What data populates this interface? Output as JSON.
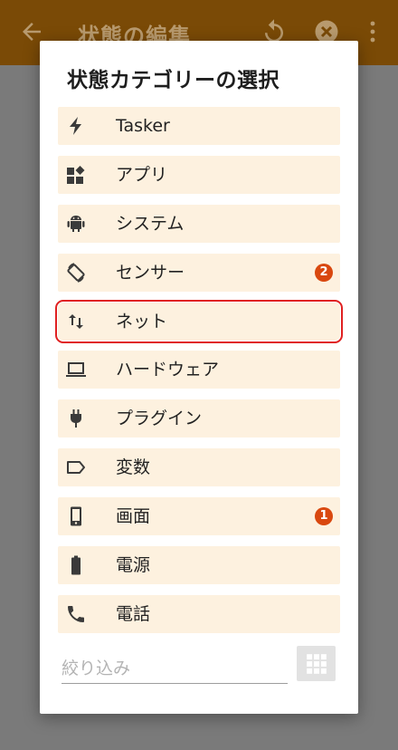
{
  "appbar": {
    "title": "状態の編集",
    "background": "#7a4a06"
  },
  "dialog": {
    "title": "状態カテゴリーの選択",
    "items_background": "#fdf1df",
    "badge_color": "#d9480f",
    "selected_outline": "#e02020"
  },
  "categories": [
    {
      "label": "Tasker",
      "icon": "bolt-icon"
    },
    {
      "label": "アプリ",
      "icon": "widgets-icon"
    },
    {
      "label": "システム",
      "icon": "android-icon"
    },
    {
      "label": "センサー",
      "icon": "screen-rotation-icon",
      "badge": "2"
    },
    {
      "label": "ネット",
      "icon": "swap-vertical-icon",
      "selected": true
    },
    {
      "label": "ハードウェア",
      "icon": "laptop-icon"
    },
    {
      "label": "プラグイン",
      "icon": "plug-icon"
    },
    {
      "label": "変数",
      "icon": "label-icon"
    },
    {
      "label": "画面",
      "icon": "phone-device-icon",
      "badge": "1"
    },
    {
      "label": "電源",
      "icon": "battery-icon"
    },
    {
      "label": "電話",
      "icon": "phone-call-icon"
    }
  ],
  "filter": {
    "placeholder": "絞り込み",
    "value": ""
  }
}
